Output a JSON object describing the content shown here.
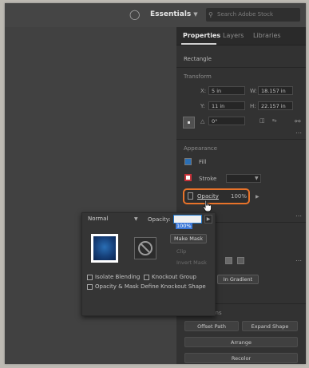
{
  "topbar": {
    "workspace": "Essentials",
    "search_placeholder": "Search Adobe Stock"
  },
  "panel": {
    "tabs": [
      "Properties",
      "Layers",
      "Libraries"
    ],
    "active_tab": "Properties",
    "object_type": "Rectangle",
    "transform": {
      "title": "Transform",
      "x_label": "X:",
      "x": "5 in",
      "y_label": "Y:",
      "y": "11 in",
      "w_label": "W:",
      "w": "18.157 in",
      "h_label": "H:",
      "h": "22.157 in",
      "angle": "0°"
    },
    "appearance": {
      "title": "Appearance",
      "fill_label": "Fill",
      "stroke_label": "Stroke",
      "opacity_label": "Opacity",
      "opacity_value": "100%"
    },
    "quick_actions": {
      "title": "Quick Actions",
      "offset_path": "Offset Path",
      "expand_shape": "Expand Shape",
      "arrange": "Arrange",
      "recolor": "Recolor"
    }
  },
  "transparency_popup": {
    "blend_mode": "Normal",
    "opacity_label": "Opacity:",
    "opacity_value": "100%",
    "make_mask": "Make Mask",
    "clip_label": "Clip",
    "invert_mask_label": "Invert Mask",
    "isolate_blending": "Isolate Blending",
    "knockout_group": "Knockout Group",
    "opacity_mask_define": "Opacity & Mask Define Knockout Shape",
    "gradient_button": "In Gradient"
  },
  "colors": {
    "highlight": "#e8732a",
    "selection": "#3c78d8",
    "fill_swatch": "#2a6fb5",
    "stroke_swatch": "#c7323a"
  }
}
